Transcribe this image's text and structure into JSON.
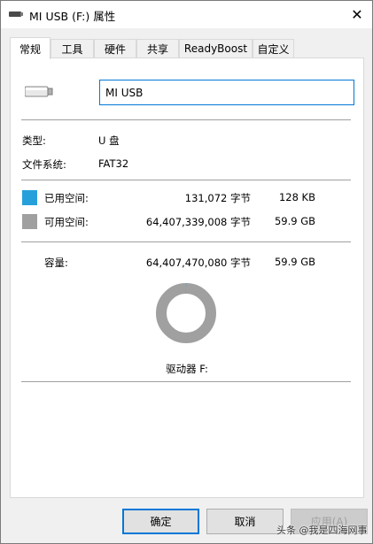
{
  "window": {
    "title": "MI USB (F:) 属性",
    "close_glyph": "✕",
    "title_icon": "usb-drive-icon"
  },
  "tabs": [
    {
      "label": "常规",
      "active": true
    },
    {
      "label": "工具",
      "active": false
    },
    {
      "label": "硬件",
      "active": false
    },
    {
      "label": "共享",
      "active": false
    },
    {
      "label": "ReadyBoost",
      "active": false
    },
    {
      "label": "自定义",
      "active": false
    }
  ],
  "general": {
    "drive_icon": "usb-drive-icon",
    "name_value": "MI USB",
    "type_label": "类型:",
    "type_value": "U 盘",
    "fs_label": "文件系统:",
    "fs_value": "FAT32",
    "used": {
      "label": "已用空间:",
      "bytes": "131,072 字节",
      "human": "128 KB",
      "color": "#26a0da"
    },
    "free": {
      "label": "可用空间:",
      "bytes": "64,407,339,008 字节",
      "human": "59.9 GB",
      "color": "#a0a0a0"
    },
    "capacity": {
      "label": "容量:",
      "bytes": "64,407,470,080 字节",
      "human": "59.9 GB"
    },
    "drive_label": "驱动器 F:",
    "used_fraction": 2e-06
  },
  "buttons": {
    "ok": "确定",
    "cancel": "取消",
    "apply": "应用(A)"
  },
  "watermark": "头条 @我是四海网事"
}
